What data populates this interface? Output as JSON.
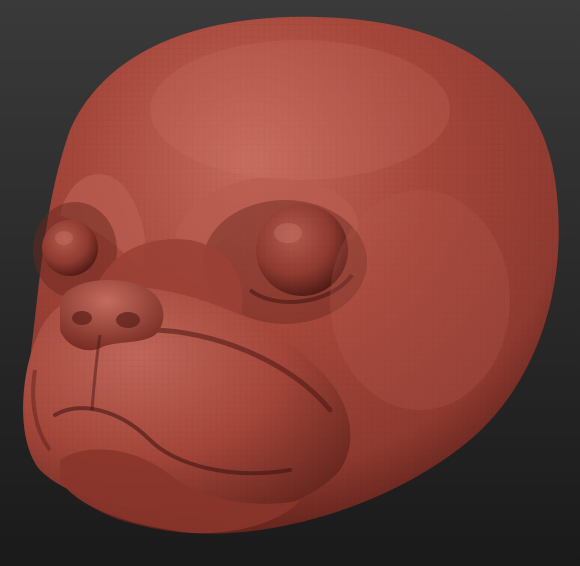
{
  "viewport": {
    "background": {
      "top_color": "#3a3a3a",
      "bottom_color": "#1a1a1a"
    },
    "model": {
      "subject": "dog-head-sculpt",
      "material_colors": {
        "base": "#a5463a",
        "highlight": "#c56a5c",
        "midtone": "#8f3a30",
        "shadow": "#5a1f18",
        "deep_shadow": "#3a120e"
      },
      "wireframe_overlay": true
    }
  }
}
